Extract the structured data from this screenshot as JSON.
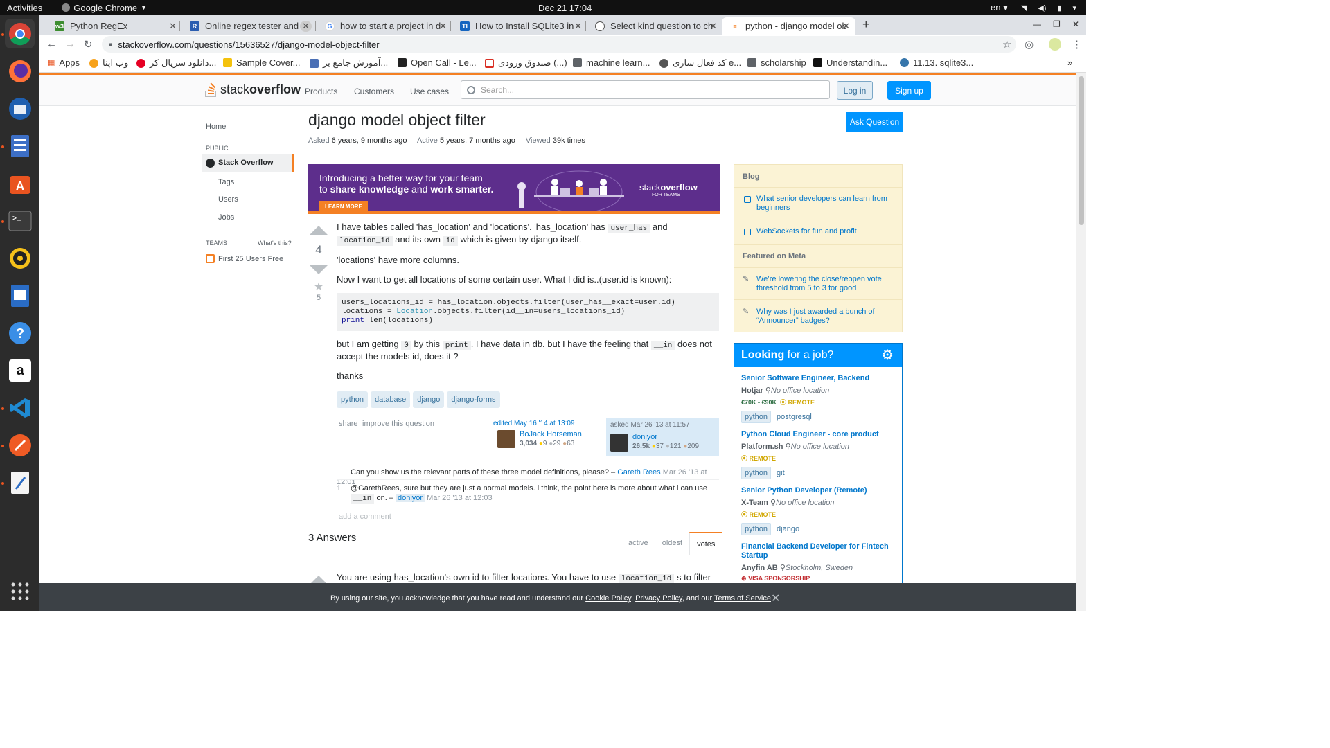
{
  "os": {
    "activities": "Activities",
    "app_name": "Google Chrome",
    "clock": "Dec 21  17:04",
    "lang": "en"
  },
  "browser": {
    "tabs": [
      {
        "label": "Python RegEx",
        "color": "#3c8d2f"
      },
      {
        "label": "Online regex tester and d",
        "color": "#2a5db0"
      },
      {
        "label": "how to start a project in d",
        "color": "#4285f4"
      },
      {
        "label": "How to Install SQLite3 in",
        "color": "#1565c0"
      },
      {
        "label": "Select kind question to ch",
        "color": "#555555"
      },
      {
        "label": "python - django model ob",
        "color": "#f48024"
      }
    ],
    "url": "stackoverflow.com/questions/15636527/django-model-object-filter",
    "bookmarks": [
      {
        "label": "Apps"
      },
      {
        "label": "وب اپنا"
      },
      {
        "label": "دانلود سریال کر..."
      },
      {
        "label": "Sample Cover..."
      },
      {
        "label": "آموزش جامع بر..."
      },
      {
        "label": "Open Call - Le..."
      },
      {
        "label": "صندوق ورودی (...)"
      },
      {
        "label": "machine learn..."
      },
      {
        "label": "کد فعال سازی e..."
      },
      {
        "label": "scholarship"
      },
      {
        "label": "Understandin..."
      },
      {
        "label": "11.13. sqlite3..."
      }
    ]
  },
  "so": {
    "logo_a": "stack",
    "logo_b": "overflow",
    "nav": [
      "Products",
      "Customers",
      "Use cases"
    ],
    "search_placeholder": "Search...",
    "login": "Log in",
    "signup": "Sign up",
    "left": {
      "home": "Home",
      "public": "PUBLIC",
      "stack_overflow": "Stack Overflow",
      "tags": "Tags",
      "users": "Users",
      "jobs": "Jobs",
      "teams": "TEAMS",
      "whats_this": "What's this?",
      "first25": "First 25 Users Free"
    },
    "question": {
      "title": "django model object filter",
      "asked_label": "Asked",
      "asked": "6 years, 9 months ago",
      "active_label": "Active",
      "active": "5 years, 7 months ago",
      "viewed_label": "Viewed",
      "viewed": "39k times",
      "ask_button": "Ask Question",
      "votes": "4",
      "favorites": "5",
      "p1_a": "I have tables called 'has_location' and 'locations'. 'has_location' has",
      "p1_code1": "user_has",
      "p1_b": "and",
      "p1_code2": "location_id",
      "p1_c": "and its own",
      "p1_code3": "id",
      "p1_d": "which is given by django itself.",
      "p2": "'locations' have more columns.",
      "p3": "Now I want to get all locations of some certain user. What I did is..(user.id is known):",
      "code_l1": "users_locations_id = has_location.objects.filter(user_has__exact=user.id)",
      "code_l2a": "locations = ",
      "code_l2b": "Location",
      "code_l2c": ".objects.filter(id__in=users_locations_id)",
      "code_l3a": "print",
      "code_l3b": " len(locations)",
      "p4_a": "but I am getting",
      "p4_code1": "0",
      "p4_b": "by this",
      "p4_code2": "print",
      "p4_c": ". I have data in db. but I have the feeling that",
      "p4_code3": "__in",
      "p4_d": "does not accept the models id, does it ?",
      "p5": "thanks",
      "tags": [
        "python",
        "database",
        "django",
        "django-forms"
      ],
      "share": "share",
      "improve": "improve this question",
      "edited": "edited May 16 '14 at 13:09",
      "editor": "BoJack Horseman",
      "editor_rep": "3,034",
      "editor_gold": "9",
      "editor_silver": "29",
      "editor_bronze": "63",
      "asked_at": "asked Mar 26 '13 at 11:57",
      "asker": "doniyor",
      "asker_rep": "26.5k",
      "asker_gold": "37",
      "asker_silver": "121",
      "asker_bronze": "209"
    },
    "comments": [
      {
        "score": "",
        "text": "Can you show us the relevant parts of these three model definitions, please? –",
        "user": "Gareth Rees",
        "date": "Mar 26 '13 at 12:01"
      },
      {
        "score": "1",
        "text": "@GarethRees, sure but they are just a normal models. i think, the point here is more about what i can use",
        "code": "__in",
        "text2": "on. –",
        "user": "doniyor",
        "date": "Mar 26 '13 at 12:03"
      }
    ],
    "add_comment": "add a comment",
    "answers_header": "3 Answers",
    "sort": [
      "active",
      "oldest",
      "votes"
    ],
    "answer1_a": "You are using has_location's own id to filter locations. You have to use",
    "answer1_code": "location_id",
    "answer1_b": "s to filter",
    "banner": {
      "line1": "Introducing a better way for your team",
      "line2a": "to ",
      "line2b": "share knowledge",
      "line2c": " and ",
      "line2d": "work smarter.",
      "learn": "LEARN MORE",
      "brand_a": "stack",
      "brand_b": "overflow",
      "brand_sub": "FOR TEAMS"
    },
    "blog": {
      "header": "Blog",
      "items": [
        "What senior developers can learn from beginners",
        "WebSockets for fun and profit"
      ],
      "meta_header": "Featured on Meta",
      "meta_items": [
        "We’re lowering the close/reopen vote threshold from 5 to 3 for good",
        "Why was I just awarded a bunch of “Announcer” badges?"
      ]
    },
    "jobs": {
      "header_a": "Looking",
      "header_b": " for a job?",
      "list": [
        {
          "title": "Senior Software Engineer, Backend",
          "company": "Hotjar",
          "location": "No office location",
          "salary": "€70K - €90K",
          "remote": "REMOTE",
          "tags": [
            "python",
            "postgresql"
          ]
        },
        {
          "title": "Python Cloud Engineer - core product",
          "company": "Platform.sh",
          "location": "No office location",
          "remote": "REMOTE",
          "tags": [
            "python",
            "git"
          ]
        },
        {
          "title": "Senior Python Developer (Remote)",
          "company": "X-Team",
          "location": "No office location",
          "remote": "REMOTE",
          "tags": [
            "python",
            "django"
          ]
        },
        {
          "title": "Financial Backend Developer for Fintech Startup",
          "company": "Anyfin AB",
          "location": "Stockholm, Sweden",
          "visa": "VISA SPONSORSHIP"
        }
      ]
    },
    "cookie": {
      "text": "By using our site, you acknowledge that you have read and understand our",
      "cookie_policy": "Cookie Policy",
      "privacy": "Privacy Policy",
      "and": ", and our",
      "tos": "Terms of Service",
      "end": "."
    }
  }
}
